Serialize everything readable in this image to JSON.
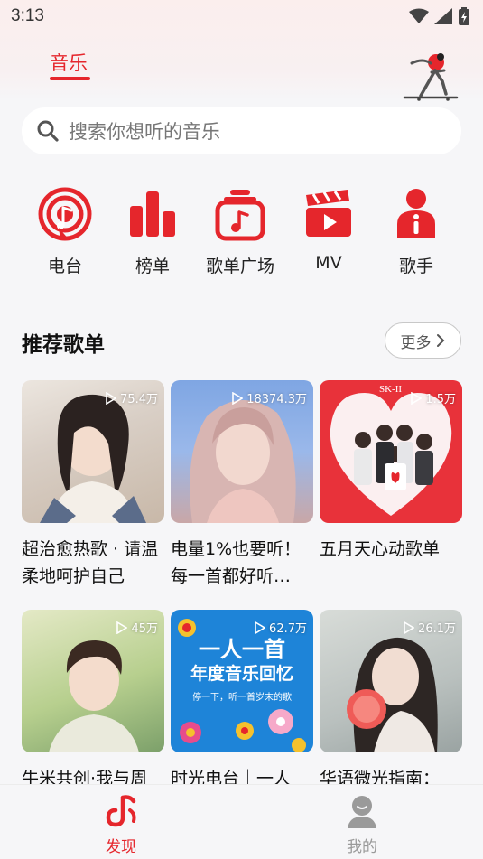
{
  "status": {
    "time": "3:13"
  },
  "header": {
    "tab_music": "音乐"
  },
  "search": {
    "placeholder": "搜索你想听的音乐"
  },
  "quick_nav": [
    {
      "label": "电台",
      "icon": "radio-icon"
    },
    {
      "label": "榜单",
      "icon": "chart-icon"
    },
    {
      "label": "歌单广场",
      "icon": "playlist-square-icon"
    },
    {
      "label": "MV",
      "icon": "mv-icon"
    },
    {
      "label": "歌手",
      "icon": "singer-icon"
    }
  ],
  "recommend": {
    "title": "推荐歌单",
    "more_label": "更多",
    "playlists": [
      {
        "title": "超治愈热歌 · 请温柔地呵护自己",
        "play_count": "75.4万"
      },
      {
        "title": "电量1%也要听！每一首都好听…",
        "play_count": "18374.3万"
      },
      {
        "title": "五月天心动歌单",
        "play_count": "1.5万"
      },
      {
        "title": "牛米共创·我与周",
        "play_count": "45万"
      },
      {
        "title": "时光电台｜一人",
        "play_count": "62.7万"
      },
      {
        "title": "华语微光指南：",
        "play_count": "26.1万"
      }
    ]
  },
  "cover_texts": {
    "skii_brand": "SK-II",
    "card5_line1": "一人一首",
    "card5_line2": "年度音乐回忆",
    "card5_line3": "停一下，听一首岁末的歌"
  },
  "bottom_nav": {
    "discover": "发现",
    "mine": "我的"
  },
  "colors": {
    "accent": "#e5262c",
    "inactive": "#9a9a9a"
  }
}
